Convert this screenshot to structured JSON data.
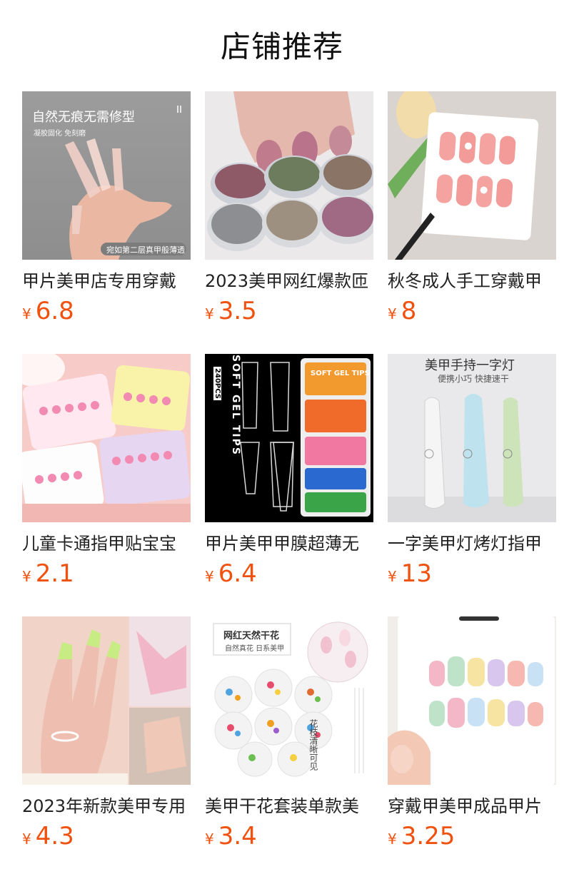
{
  "page": {
    "title": "店铺推荐"
  },
  "currency_symbol": "¥",
  "products": [
    {
      "name": "甲片美甲店专用穿戴",
      "price": "6.8",
      "image": {
        "icon": "nail-tips-hand-image",
        "headline": "自然无痕无需修型",
        "subline": "凝胶固化 免刻磨",
        "tag": "宛如第二层真甲般薄透"
      }
    },
    {
      "name": "2023美甲网红爆款匝",
      "price": "3.5",
      "image": {
        "icon": "chrome-powder-jars-image"
      }
    },
    {
      "name": "秋冬成人手工穿戴甲",
      "price": "8",
      "image": {
        "icon": "press-on-nails-card-image"
      }
    },
    {
      "name": "儿童卡通指甲贴宝宝",
      "price": "2.1",
      "image": {
        "icon": "kids-nail-sticker-packs-image"
      }
    },
    {
      "name": "甲片美甲甲膜超薄无",
      "price": "6.4",
      "image": {
        "icon": "soft-gel-tips-box-image",
        "vertical_label": "SOFT GEL TIPS",
        "count_label": "240PCS",
        "box_label": "SOFT GEL TIPS"
      }
    },
    {
      "name": "一字美甲灯烤灯指甲",
      "price": "13",
      "image": {
        "icon": "handheld-uv-lamp-image",
        "headline": "美甲手持一字灯",
        "subline": "便携小巧 快捷速干"
      }
    },
    {
      "name": "2023年新款美甲专用",
      "price": "4.3",
      "image": {
        "icon": "french-tip-nails-collage-image"
      }
    },
    {
      "name": "美甲干花套装单款美",
      "price": "3.4",
      "image": {
        "icon": "dried-flower-set-image",
        "headline": "网红天然干花",
        "subline": "自然真花 日系美甲",
        "side_text": "花枝清晰可见"
      }
    },
    {
      "name": "穿戴甲美甲成品甲片",
      "price": "3.25",
      "image": {
        "icon": "cartoon-press-on-nails-image"
      }
    }
  ]
}
